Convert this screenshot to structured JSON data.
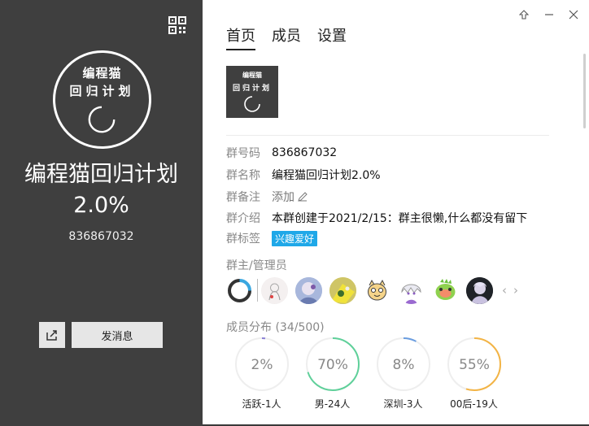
{
  "group": {
    "logo_line1": "编程猫",
    "logo_line2": "回归计划",
    "name_line1": "编程猫回归计划",
    "name_line2": "2.0%",
    "id": "836867032"
  },
  "actions": {
    "send_message": "发消息"
  },
  "tabs": [
    {
      "label": "首页",
      "active": true
    },
    {
      "label": "成员",
      "active": false
    },
    {
      "label": "设置",
      "active": false
    }
  ],
  "info": {
    "id_label": "群号码",
    "id_value": "836867032",
    "name_label": "群名称",
    "name_value": "编程猫回归计划2.0%",
    "remark_label": "群备注",
    "remark_value": "添加",
    "intro_label": "群介绍",
    "intro_value": "本群创建于2021/2/15：群主很懒,什么都没有留下",
    "tag_label": "群标签",
    "tag_value": "兴趣爱好"
  },
  "admins": {
    "title": "群主/管理员",
    "avatars": [
      {
        "icon": "spinner-logo-avatar"
      },
      {
        "icon": "anime-girl-sketch-avatar"
      },
      {
        "icon": "character-blue-avatar"
      },
      {
        "icon": "yellow-character-avatar"
      },
      {
        "icon": "cat-cartoon-avatar"
      },
      {
        "icon": "white-hair-character-avatar"
      },
      {
        "icon": "green-bird-avatar"
      },
      {
        "icon": "anime-character-dark-avatar"
      }
    ]
  },
  "distribution": {
    "title": "成员分布",
    "count": "(34/500)",
    "stats": [
      {
        "percent": "2%",
        "fraction": 0.02,
        "label": "活跃-1人",
        "color": "#8a7fd6"
      },
      {
        "percent": "70%",
        "fraction": 0.7,
        "label": "男-24人",
        "color": "#5fd09a"
      },
      {
        "percent": "8%",
        "fraction": 0.08,
        "label": "深圳-3人",
        "color": "#6a9de0"
      },
      {
        "percent": "55%",
        "fraction": 0.55,
        "label": "00后-19人",
        "color": "#f3b445"
      }
    ]
  },
  "colors": {
    "left_panel": "#3f3f3f",
    "tag_bg": "#1fa8e8"
  }
}
